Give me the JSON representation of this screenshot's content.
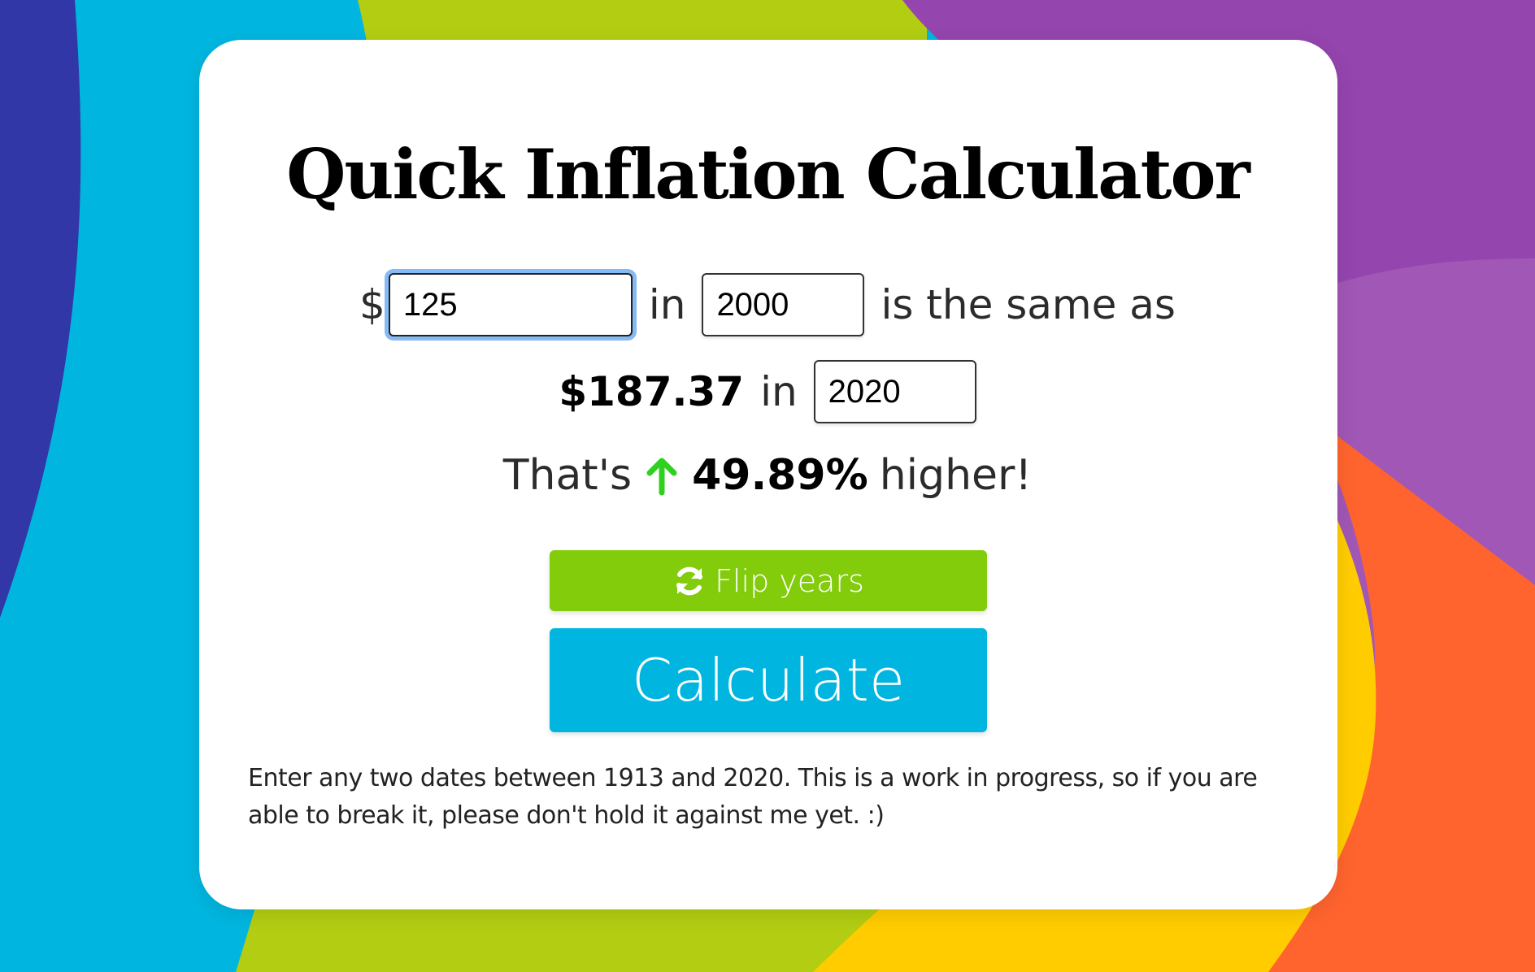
{
  "title": "Quick Inflation Calculator",
  "form": {
    "currency_symbol": "$",
    "amount_value": "125",
    "in_label_1": "in",
    "from_year_value": "2000",
    "same_as_label": "is the same as",
    "result_amount": "$187.37",
    "in_label_2": "in",
    "to_year_value": "2020"
  },
  "summary": {
    "prefix": "That's",
    "direction_icon": "arrow-up-icon",
    "percent": "49.89%",
    "suffix": "higher!"
  },
  "buttons": {
    "flip_label": "Flip years",
    "flip_icon": "refresh-icon",
    "calculate_label": "Calculate"
  },
  "note": "Enter any two dates between 1913 and 2020. This is a work in progress, so if you are able to break it, please don't hold it against me yet. :)",
  "colors": {
    "flip_button": "#82cc0b",
    "calculate_button": "#00b6e0",
    "up_arrow": "#2fd11f",
    "focus_ring": "#86b9f5",
    "bg_indigo": "#3137a6",
    "bg_cyan": "#00b6e0",
    "bg_lime": "#b2cd12",
    "bg_purple": "#9545ae",
    "bg_light_purple": "#a057b5",
    "bg_orange": "#ff642e",
    "bg_yellow": "#ffcc00"
  }
}
